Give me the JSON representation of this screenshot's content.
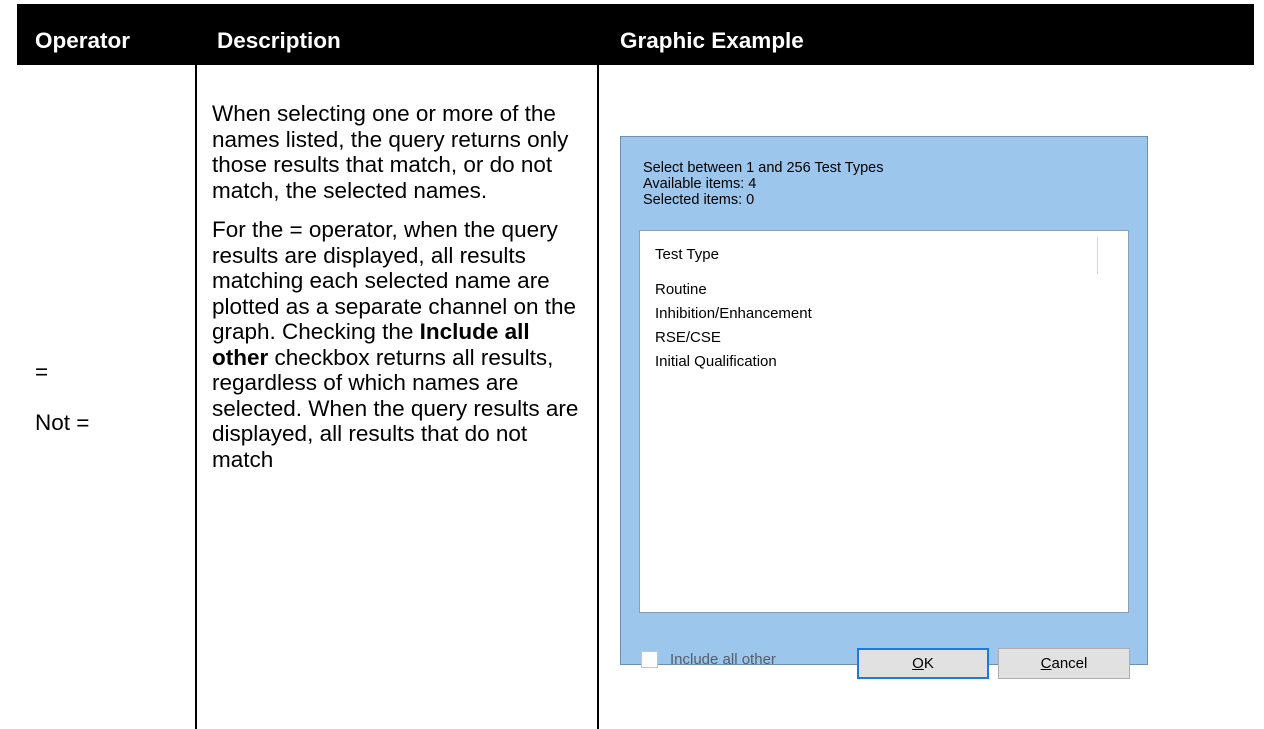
{
  "table": {
    "headers": [
      "Operator",
      "Description",
      "Graphic Example"
    ],
    "operators": [
      "=",
      "Not ="
    ],
    "description": {
      "para1": "When selecting one or more of the names listed, the query returns only those results that match, or do not match, the selected names.",
      "para2_part1": "For the = operator, when the query results are displayed, all results matching each selected name are plotted as a separate channel on the graph. Checking the",
      "para2_bold": "Include all other",
      "para2_part2": "checkbox returns all results, regardless of which names are selected. When the query results are displayed, all results that do not match"
    }
  },
  "dialog": {
    "info_lines": [
      "Select between 1 and 256 Test Types",
      "Available items: 4",
      "Selected items: 0"
    ],
    "column_header": "Test Type",
    "items": [
      "Routine",
      "Inhibition/Enhancement",
      "RSE/CSE",
      "Initial Qualification"
    ],
    "checkbox_label": "Include all other",
    "ok_button": {
      "mnemonic": "O",
      "rest": "K"
    },
    "cancel_button": {
      "mnemonic": "C",
      "rest": "ancel"
    }
  }
}
